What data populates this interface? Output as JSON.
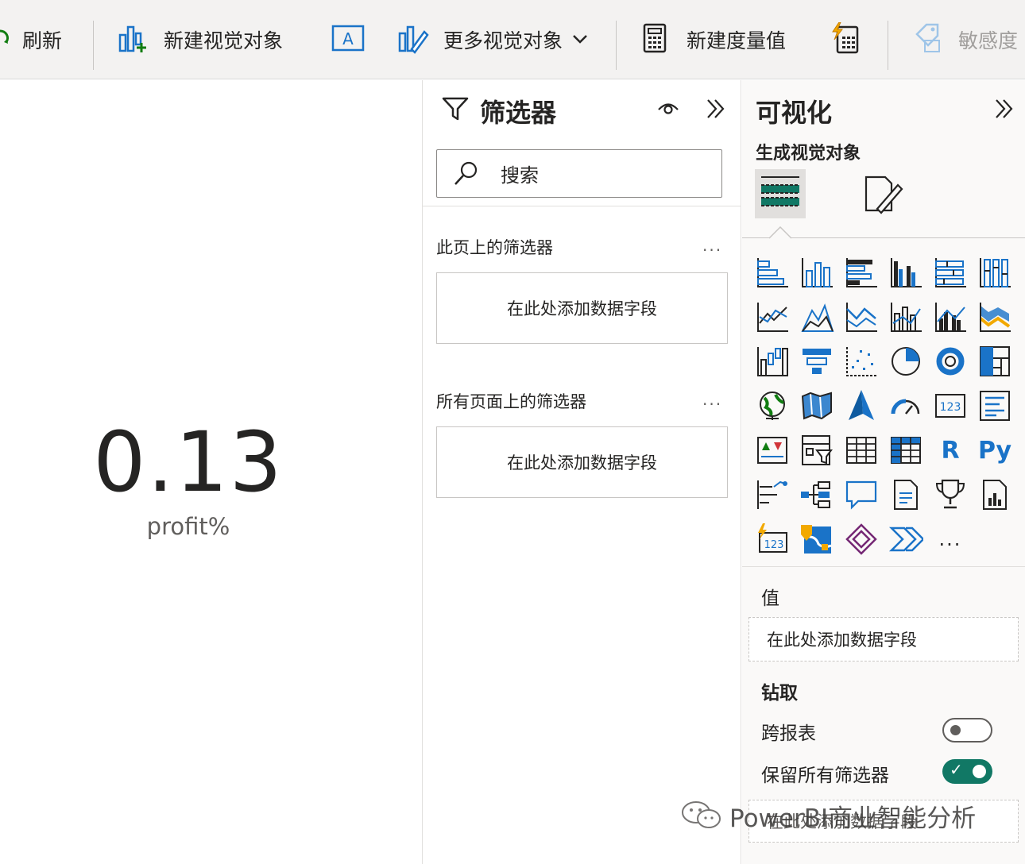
{
  "ribbon": {
    "refresh_label": "刷新",
    "new_visual_label": "新建视觉对象",
    "more_visuals_label": "更多视觉对象",
    "new_measure_label": "新建度量值",
    "sensitivity_label": "敏感度"
  },
  "canvas": {
    "card_value": "0.13",
    "card_label": "profit%"
  },
  "filters": {
    "title": "筛选器",
    "search_placeholder": "搜索",
    "this_page_title": "此页上的筛选器",
    "this_page_well": "在此处添加数据字段",
    "all_pages_title": "所有页面上的筛选器",
    "all_pages_well": "在此处添加数据字段",
    "more": "..."
  },
  "viz": {
    "title": "可视化",
    "subtitle": "生成视觉对象",
    "r_label": "R",
    "py_label": "Py",
    "more": "...",
    "values_label": "值",
    "values_well": "在此处添加数据字段",
    "drill_label": "钻取",
    "cross_report_label": "跨报表",
    "cross_report_on": false,
    "keep_filters_label": "保留所有筛选器",
    "keep_filters_on": true,
    "bottom_well": "在此处添加数据字段"
  },
  "watermark": {
    "text": "PowerBI商业智能分析"
  },
  "colors": {
    "accent": "#1a73c8",
    "toggle_on": "#117865",
    "ribbon_bg": "#f3f2f1"
  }
}
